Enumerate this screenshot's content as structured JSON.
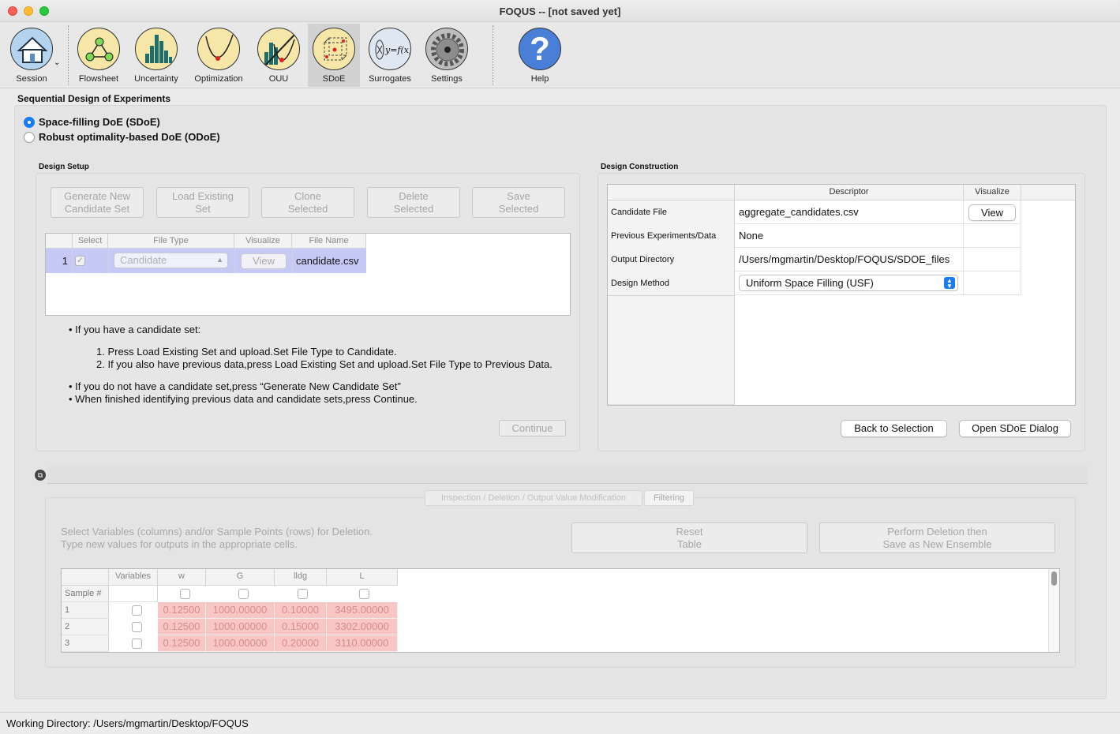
{
  "window": {
    "title": "FOQUS -- [not saved yet]"
  },
  "toolbar": {
    "items": [
      {
        "label": "Session",
        "icon": "house-icon"
      },
      {
        "label": "Flowsheet",
        "icon": "flowsheet-icon"
      },
      {
        "label": "Uncertainty",
        "icon": "histogram-icon"
      },
      {
        "label": "Optimization",
        "icon": "optimization-curve-icon"
      },
      {
        "label": "OUU",
        "icon": "ouu-icon"
      },
      {
        "label": "SDoE",
        "icon": "sdoe-cube-icon"
      },
      {
        "label": "Surrogates",
        "icon": "surrogate-function-icon"
      },
      {
        "label": "Settings",
        "icon": "gear-icon"
      },
      {
        "label": "Help",
        "icon": "question-mark-icon"
      }
    ],
    "help_glyph": "?",
    "surrogate_glyph": "y=f(x)",
    "active": "SDoE"
  },
  "page": {
    "title": "Sequential Design of Experiments",
    "radio_sdoe": "Space-filling DoE (SDoE)",
    "radio_odoe": "Robust optimality-based DoE (ODoE)",
    "selected_mode": "sdoe"
  },
  "design_setup": {
    "title": "Design Setup",
    "buttons": {
      "generate_l1": "Generate New",
      "generate_l2": "Candidate Set",
      "load_l1": "Load Existing",
      "load_l2": "Set",
      "clone_l1": "Clone",
      "clone_l2": "Selected",
      "delete_l1": "Delete",
      "delete_l2": "Selected",
      "save_l1": "Save",
      "save_l2": "Selected"
    },
    "table_headers": {
      "select": "Select",
      "file_type": "File Type",
      "visualize": "Visualize",
      "file_name": "File Name"
    },
    "row": {
      "index": "1",
      "file_type": "Candidate",
      "view": "View",
      "file_name": "candidate.csv"
    },
    "instructions": {
      "bullet1": "If you have a candidate set:",
      "step1": "1. Press Load Existing Set and upload.Set File Type to Candidate.",
      "step2": "2. If you also have previous data,press Load Existing Set and upload.Set File Type to Previous Data.",
      "bullet2": "If you do not have a candidate set,press “Generate New Candidate Set”",
      "bullet3": "When finished identifying previous data and candidate sets,press Continue."
    },
    "continue": "Continue"
  },
  "design_construction": {
    "title": "Design Construction",
    "headers": {
      "descriptor": "Descriptor",
      "visualize": "Visualize"
    },
    "rows": {
      "candidate_label": "Candidate File",
      "candidate_value": "aggregate_candidates.csv",
      "candidate_view": "View",
      "previous_label": "Previous Experiments/Data",
      "previous_value": "None",
      "output_label": "Output Directory",
      "output_value": "/Users/mgmartin/Desktop/FOQUS/SDOE_files",
      "method_label": "Design Method",
      "method_value": "Uniform Space Filling (USF)"
    },
    "back": "Back to Selection",
    "open_dialog": "Open SDoE Dialog"
  },
  "inspection": {
    "tab_inspection": "Inspection / Deletion / Output Value Modification",
    "tab_filtering": "Filtering",
    "desc_l1": "Select Variables (columns) and/or Sample Points (rows) for Deletion.",
    "desc_l2": "Type new values for outputs in the appropriate cells.",
    "reset_l1": "Reset",
    "reset_l2": "Table",
    "perform_l1": "Perform Deletion then",
    "perform_l2": "Save as New Ensemble",
    "table": {
      "variables_header": "Variables",
      "sample_header": "Sample #",
      "columns": [
        "w",
        "G",
        "lldg",
        "L"
      ],
      "rows": [
        {
          "n": "1",
          "w": "0.12500",
          "G": "1000.00000",
          "lldg": "0.10000",
          "L": "3495.00000"
        },
        {
          "n": "2",
          "w": "0.12500",
          "G": "1000.00000",
          "lldg": "0.15000",
          "L": "3302.00000"
        },
        {
          "n": "3",
          "w": "0.12500",
          "G": "1000.00000",
          "lldg": "0.20000",
          "L": "3110.00000"
        }
      ]
    }
  },
  "status": {
    "working_directory": "Working Directory: /Users/mgmartin/Desktop/FOQUS"
  },
  "colors": {
    "accent": "#1a7cf5",
    "selection_row": "#c6c8f5",
    "deleted_cell": "#f9c6c6"
  }
}
